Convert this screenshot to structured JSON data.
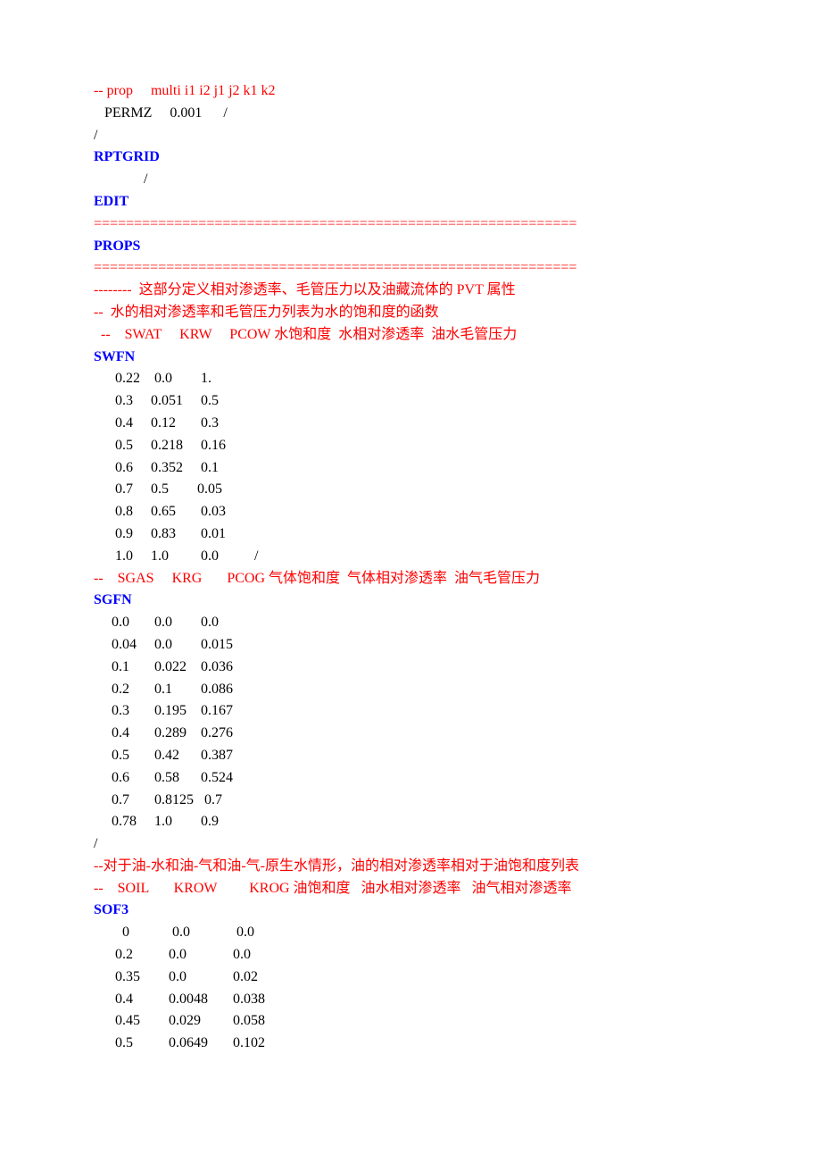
{
  "line_header_prop": "-- prop     multi i1 i2 j1 j2 k1 k2",
  "line_permz": "   PERMZ     0.001      /",
  "slash1": "/",
  "kw_rptgrid": "RPTGRID",
  "line_rptgrid_slash": "              /",
  "kw_edit": "EDIT",
  "ruler": "============================================================",
  "kw_props": "PROPS",
  "cmt_section_desc": "--------  这部分定义相对渗透率、毛管压力以及油藏流体的 PVT 属性",
  "cmt_water_desc": "--  水的相对渗透率和毛管压力列表为水的饱和度的函数",
  "cmt_swat_hdr_pre": "  --    SWAT     KRW     PCOW ",
  "cmt_swat_hdr_post": "水饱和度  水相对渗透率  油水毛管压力",
  "kw_swfn": "SWFN",
  "swfn": [
    "      0.22    0.0        1.",
    "      0.3     0.051     0.5",
    "      0.4     0.12       0.3",
    "      0.5     0.218     0.16",
    "      0.6     0.352     0.1",
    "      0.7     0.5        0.05",
    "      0.8     0.65       0.03",
    "      0.9     0.83       0.01",
    "      1.0     1.0         0.0          /"
  ],
  "cmt_sgas_hdr_pre": "--    SGAS     KRG       PCOG ",
  "cmt_sgas_hdr_post": "气体饱和度  气体相对渗透率  油气毛管压力",
  "kw_sgfn": "SGFN",
  "sgfn": [
    "     0.0       0.0        0.0",
    "     0.04     0.0        0.015",
    "     0.1       0.022    0.036",
    "     0.2       0.1        0.086",
    "     0.3       0.195    0.167",
    "     0.4       0.289    0.276",
    "     0.5       0.42      0.387",
    "     0.6       0.58      0.524",
    "     0.7       0.8125   0.7",
    "     0.78     1.0        0.9"
  ],
  "slash2": "/",
  "cmt_oil_desc": "--对于油-水和油-气和油-气-原生水情形，油的相对渗透率相对于油饱和度列表",
  "cmt_soil_hdr_pre": "--    SOIL       KROW         KROG ",
  "cmt_soil_hdr_post": "油饱和度   油水相对渗透率   油气相对渗透率",
  "kw_sof3": "SOF3",
  "sof3": [
    "        0            0.0             0.0",
    "      0.2          0.0             0.0",
    "      0.35        0.0             0.02",
    "      0.4          0.0048       0.038",
    "      0.45        0.029         0.058",
    "      0.5          0.0649       0.102"
  ],
  "chart_data": [
    {
      "type": "table",
      "title": "SWFN",
      "columns": [
        "SWAT",
        "KRW",
        "PCOW"
      ],
      "rows": [
        [
          0.22,
          0.0,
          1.0
        ],
        [
          0.3,
          0.051,
          0.5
        ],
        [
          0.4,
          0.12,
          0.3
        ],
        [
          0.5,
          0.218,
          0.16
        ],
        [
          0.6,
          0.352,
          0.1
        ],
        [
          0.7,
          0.5,
          0.05
        ],
        [
          0.8,
          0.65,
          0.03
        ],
        [
          0.9,
          0.83,
          0.01
        ],
        [
          1.0,
          1.0,
          0.0
        ]
      ]
    },
    {
      "type": "table",
      "title": "SGFN",
      "columns": [
        "SGAS",
        "KRG",
        "PCOG"
      ],
      "rows": [
        [
          0.0,
          0.0,
          0.0
        ],
        [
          0.04,
          0.0,
          0.015
        ],
        [
          0.1,
          0.022,
          0.036
        ],
        [
          0.2,
          0.1,
          0.086
        ],
        [
          0.3,
          0.195,
          0.167
        ],
        [
          0.4,
          0.289,
          0.276
        ],
        [
          0.5,
          0.42,
          0.387
        ],
        [
          0.6,
          0.58,
          0.524
        ],
        [
          0.7,
          0.8125,
          0.7
        ],
        [
          0.78,
          1.0,
          0.9
        ]
      ]
    },
    {
      "type": "table",
      "title": "SOF3",
      "columns": [
        "SOIL",
        "KROW",
        "KROG"
      ],
      "rows": [
        [
          0,
          0.0,
          0.0
        ],
        [
          0.2,
          0.0,
          0.0
        ],
        [
          0.35,
          0.0,
          0.02
        ],
        [
          0.4,
          0.0048,
          0.038
        ],
        [
          0.45,
          0.029,
          0.058
        ],
        [
          0.5,
          0.0649,
          0.102
        ]
      ]
    }
  ]
}
